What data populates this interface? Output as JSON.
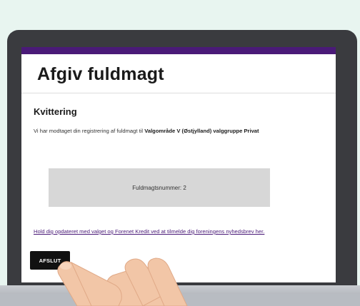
{
  "page": {
    "title": "Afgiv fuldmagt"
  },
  "receipt": {
    "heading": "Kvittering",
    "text_prefix": "Vi har modtaget din registrering af fuldmagt til ",
    "text_bold": "Valgområde V (Østjylland) valggruppe Privat",
    "number_label": "Fuldmagtsnummer: 2"
  },
  "newsletter": {
    "link_text": "Hold dig opdateret med valget og Forenet Kredit ved at tilmelde dig foreningens nyhedsbrev her."
  },
  "actions": {
    "finish_label": "AFSLUT"
  },
  "colors": {
    "brand_purple": "#4a1a78",
    "button_black": "#111111",
    "box_gray": "#d7d7d7",
    "hand_skin": "#f2c6a7"
  }
}
